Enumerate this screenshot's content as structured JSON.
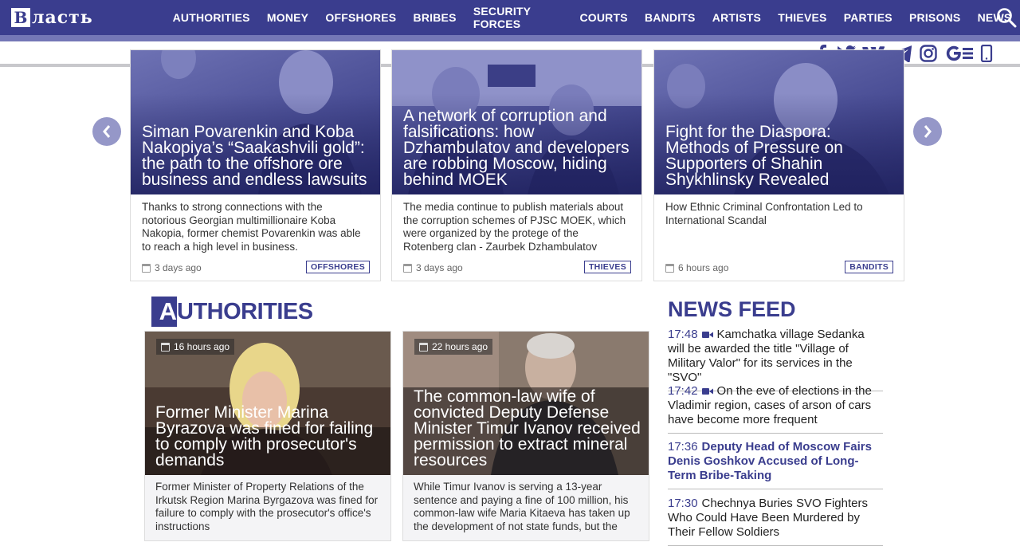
{
  "header": {
    "logo_letter": "В",
    "logo_rest": "ласть",
    "nav": [
      "AUTHORITIES",
      "MONEY",
      "OFFSHORES",
      "BRIBES",
      "SECURITY FORCES",
      "COURTS",
      "BANDITS",
      "ARTISTS",
      "THIEVES",
      "PARTIES",
      "PRISONS",
      "NEWS"
    ]
  },
  "social": [
    "facebook-icon",
    "twitter-icon",
    "vk-icon",
    "telegram-icon",
    "instagram-icon",
    "google-news-icon",
    "mobile-icon"
  ],
  "slider": {
    "cards": [
      {
        "title": "Siman Povarenkin and Koba Nakopiya’s “Saakashvili gold”: the path to the offshore ore business and endless lawsuits",
        "desc": "Thanks to strong connections with the notorious Georgian multimillionaire Koba Nakopia, former chemist Povarenkin was able to reach a high level in business.",
        "date": "3 days ago",
        "tag": "OFFSHORES"
      },
      {
        "title": "A network of corruption and falsifications: how Dzhambulatov and developers are robbing Moscow, hiding behind MOEK",
        "desc": "The media continue to publish materials about the corruption schemes of PJSC MOEK, which were organized by the protege of the Rotenberg clan - Zaurbek Dzhambulatov",
        "date": "3 days ago",
        "tag": "THIEVES"
      },
      {
        "title": "Fight for the Diaspora: Methods of Pressure on Supporters of Shahin Shykhlinsky Revealed",
        "desc": "How Ethnic Criminal Confrontation Led to International Scandal",
        "date": "6 hours ago",
        "tag": "BANDITS"
      }
    ]
  },
  "section": {
    "first_letter": "A",
    "rest": "UTHORITIES",
    "cards": [
      {
        "date": "16 hours ago",
        "title": "Former Minister Marina Byrazova was fined for failing to comply with prosecutor's demands",
        "desc": "Former Minister of Property Relations of the Irkutsk Region Marina Byrgazova was fined for failure to comply with the prosecutor's office's instructions"
      },
      {
        "date": "22 hours ago",
        "title": "The common-law wife of convicted Deputy Defense Minister Timur Ivanov received permission to extract mineral resources",
        "desc": "While Timur Ivanov is serving a 13-year sentence and paying a fine of 100 million, his common-law wife Maria Kitaeva has taken up the development of not state funds, but the"
      }
    ]
  },
  "feed": {
    "heading": "NEWS FEED",
    "items": [
      {
        "time": "17:48",
        "video": true,
        "bold": false,
        "text": "Kamchatka village Sedanka will be awarded the title \"Village of Military Valor\" for its services in the \"SVO\""
      },
      {
        "time": "17:42",
        "video": true,
        "bold": false,
        "text": "On the eve of elections in the Vladimir region, cases of arson of cars have become more frequent"
      },
      {
        "time": "17:36",
        "video": false,
        "bold": true,
        "text": "Deputy Head of Moscow Fairs Denis Goshkov Accused of Long-Term Bribe-Taking"
      },
      {
        "time": "17:30",
        "video": false,
        "bold": false,
        "text": "Chechnya Buries SVO Fighters Who Could Have Been Murdered by Their Fellow Soldiers"
      }
    ]
  }
}
